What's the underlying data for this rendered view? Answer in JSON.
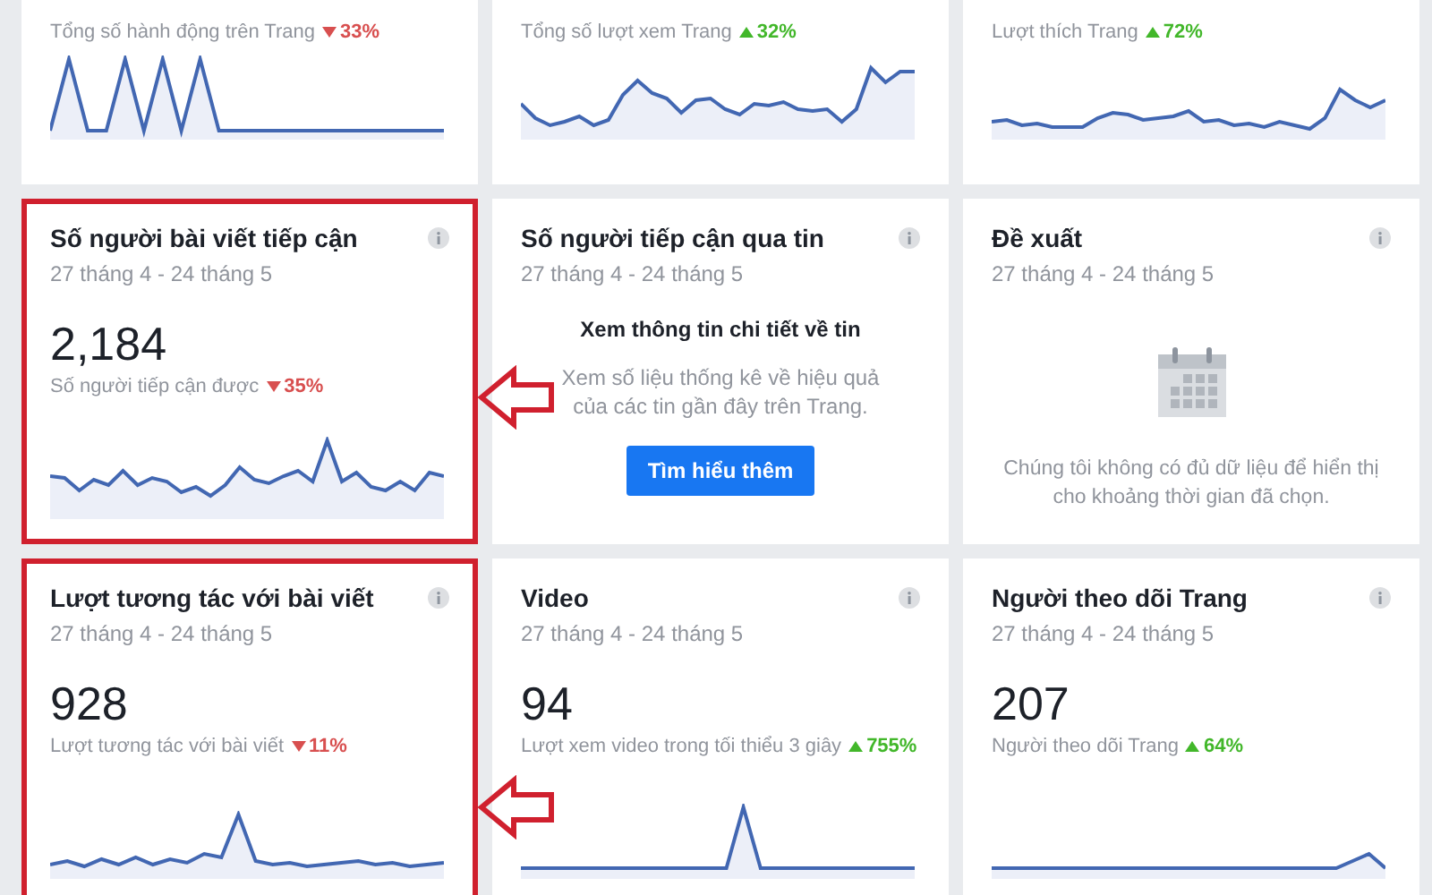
{
  "cards": [
    {
      "kind": "metric",
      "metric_label": "Tổng số hành động trên Trang",
      "change": {
        "text": "33%",
        "increase": false
      },
      "highlighted": false
    },
    {
      "kind": "metric",
      "metric_label": "Tổng số lượt xem Trang",
      "change": {
        "text": "32%",
        "increase": true
      },
      "highlighted": false
    },
    {
      "kind": "metric",
      "metric_label": "Lượt thích Trang",
      "change": {
        "text": "72%",
        "increase": true
      },
      "highlighted": false
    },
    {
      "kind": "metric",
      "title": "Số người bài viết tiếp cận",
      "date_range": "27 tháng 4 - 24 tháng 5",
      "value": "2,184",
      "metric_label": "Số người tiếp cận được",
      "change": {
        "text": "35%",
        "increase": false
      },
      "highlighted": true
    },
    {
      "kind": "promo",
      "title": "Số người tiếp cận qua tin",
      "date_range": "27 tháng 4 - 24 tháng 5",
      "heading": "Xem thông tin chi tiết về tin",
      "body": "Xem số liệu thống kê về hiệu quả của các tin gần đây trên Trang.",
      "button": "Tìm hiểu thêm",
      "highlighted": false
    },
    {
      "kind": "empty",
      "title": "Đề xuất",
      "date_range": "27 tháng 4 - 24 tháng 5",
      "message": "Chúng tôi không có đủ dữ liệu để hiển thị cho khoảng thời gian đã chọn.",
      "highlighted": false
    },
    {
      "kind": "metric",
      "title": "Lượt tương tác với bài viết",
      "date_range": "27 tháng 4 - 24 tháng 5",
      "value": "928",
      "metric_label": "Lượt tương tác với bài viết",
      "change": {
        "text": "11%",
        "increase": false
      },
      "highlighted": true
    },
    {
      "kind": "metric",
      "title": "Video",
      "date_range": "27 tháng 4 - 24 tháng 5",
      "value": "94",
      "metric_label": "Lượt xem video trong tối thiểu 3 giây",
      "change": {
        "text": "755%",
        "increase": true
      },
      "highlighted": false
    },
    {
      "kind": "metric",
      "title": "Người theo dõi Trang",
      "date_range": "27 tháng 4 - 24 tháng 5",
      "value": "207",
      "metric_label": "Người theo dõi Trang",
      "change": {
        "text": "64%",
        "increase": true
      },
      "highlighted": false
    }
  ]
}
